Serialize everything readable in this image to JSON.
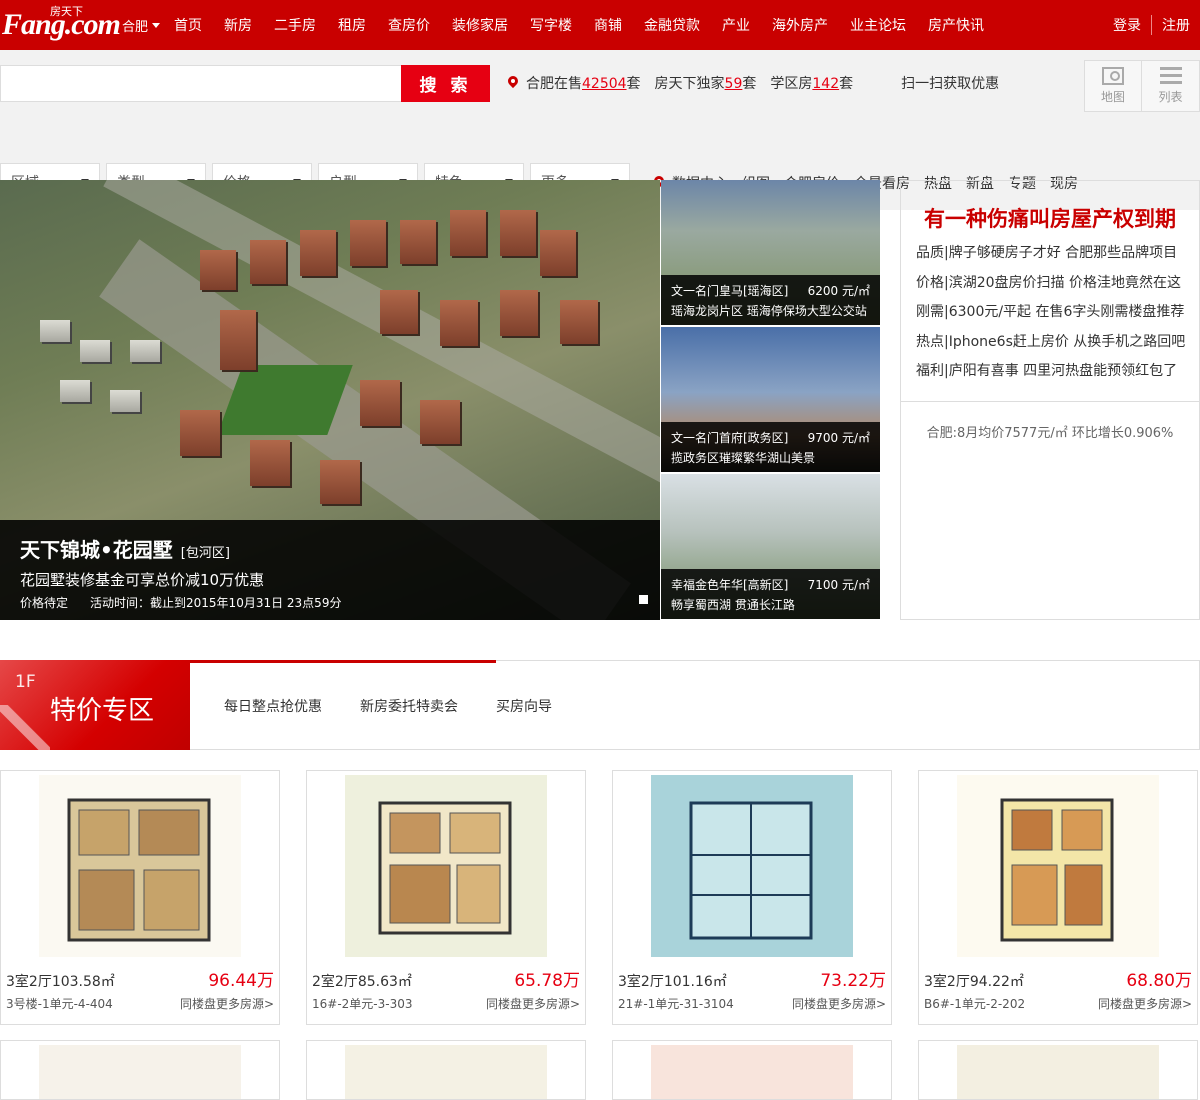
{
  "header": {
    "logo_text": "Fang.com",
    "logo_sub": "房天下",
    "city": "合肥",
    "nav": [
      "首页",
      "新房",
      "二手房",
      "租房",
      "查房价",
      "装修家居",
      "写字楼",
      "商铺",
      "金融贷款",
      "产业",
      "海外房产",
      "业主论坛",
      "房产快讯"
    ],
    "login": "登录",
    "register": "注册"
  },
  "search": {
    "button": "搜 索",
    "placeholder": "",
    "stats": {
      "sale_prefix": "合肥在售",
      "sale_count": "42504",
      "sale_suffix": "套",
      "exclusive_prefix": "房天下独家",
      "exclusive_count": "59",
      "exclusive_suffix": "套",
      "school_prefix": "学区房",
      "school_count": "142",
      "school_suffix": "套",
      "scan": "扫一扫获取优惠"
    },
    "view_map": "地图",
    "view_list": "列表",
    "filters": [
      "区域",
      "类型",
      "价格",
      "户型",
      "特色",
      "更多"
    ],
    "quick_links": [
      "数据中心",
      "组图",
      "合肥房价",
      "全景看房",
      "热盘",
      "新盘",
      "专题",
      "现房"
    ]
  },
  "banner": {
    "title": "天下锦城•花园墅",
    "district": "[包河区]",
    "subtitle": "花园墅装修基金可享总价减10万优惠",
    "price": "价格待定",
    "activity": "活动时间：截止到2015年10月31日 23点59分",
    "thumbs": [
      {
        "name": "文一名门皇马[瑶海区]",
        "price": "6200 元/㎡",
        "desc": "瑶海龙岗片区 瑶海停保场大型公交站"
      },
      {
        "name": "文一名门首府[政务区]",
        "price": "9700 元/㎡",
        "desc": "揽政务区璀璨繁华湖山美景"
      },
      {
        "name": "幸福金色年华[高新区]",
        "price": "7100 元/㎡",
        "desc": "畅享蜀西湖 贯通长江路"
      }
    ]
  },
  "news": {
    "headline": "有一种伤痛叫房屋产权到期",
    "items": [
      "品质|牌子够硬房子才好 合肥那些品牌项目",
      "价格|滨湖20盘房价扫描 价格洼地竟然在这",
      "刚需|6300元/平起 在售6字头刚需楼盘推荐",
      "热点|Iphone6s赶上房价 从换手机之路回吧",
      "福利|庐阳有喜事 四里河热盘能预领红包了"
    ],
    "price_note": "合肥:8月均价7577元/㎡ 环比增长0.906%"
  },
  "floor": {
    "index": "1F",
    "title": "特价专区",
    "tabs": [
      "每日整点抢优惠",
      "新房委托特卖会",
      "买房向导"
    ]
  },
  "listings": [
    {
      "layout": "3室2厅103.58㎡",
      "price": "96.44万",
      "unit": "3号楼-1单元-4-404",
      "more": "同楼盘更多房源>"
    },
    {
      "layout": "2室2厅85.63㎡",
      "price": "65.78万",
      "unit": "16#-2单元-3-303",
      "more": "同楼盘更多房源>"
    },
    {
      "layout": "3室2厅101.16㎡",
      "price": "73.22万",
      "unit": "21#-1单元-31-3104",
      "more": "同楼盘更多房源>"
    },
    {
      "layout": "3室2厅94.22㎡",
      "price": "68.80万",
      "unit": "B6#-1单元-2-202",
      "more": "同楼盘更多房源>"
    }
  ],
  "colors": {
    "brand": "#c90000",
    "accent": "#e60012"
  }
}
